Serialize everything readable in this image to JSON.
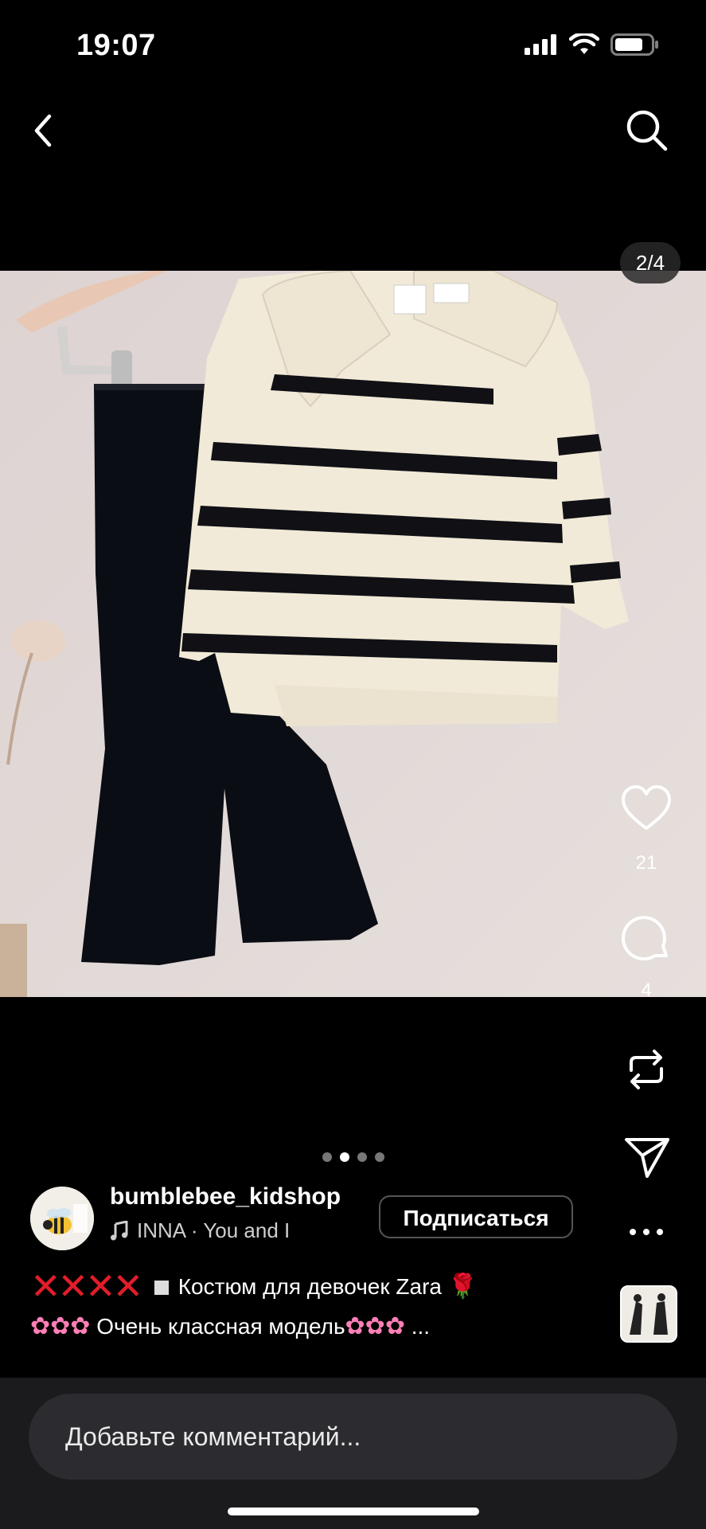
{
  "status_bar": {
    "time": "19:07"
  },
  "post": {
    "counter": "2/4",
    "likes": "21",
    "comments": "4",
    "pager": {
      "total": 4,
      "active_index": 1
    }
  },
  "account": {
    "username": "bumblebee_kidshop",
    "music": "INNA · You and I",
    "follow_label": "Подписаться"
  },
  "caption": {
    "line1_text": " Костюм для девочек Zara ",
    "line2_text": " Очень классная модель",
    "ellipsis": " ..."
  },
  "comment": {
    "placeholder": "Добавьте комментарий..."
  },
  "icons": {
    "back": "chevron-left-icon",
    "search": "search-icon",
    "like": "heart-icon",
    "comment": "comment-bubble-icon",
    "repost": "repost-icon",
    "share": "send-icon",
    "more": "more-icon",
    "music": "music-note-icon"
  },
  "colors": {
    "background": "#000000",
    "accent_red": "#e21d2a"
  }
}
